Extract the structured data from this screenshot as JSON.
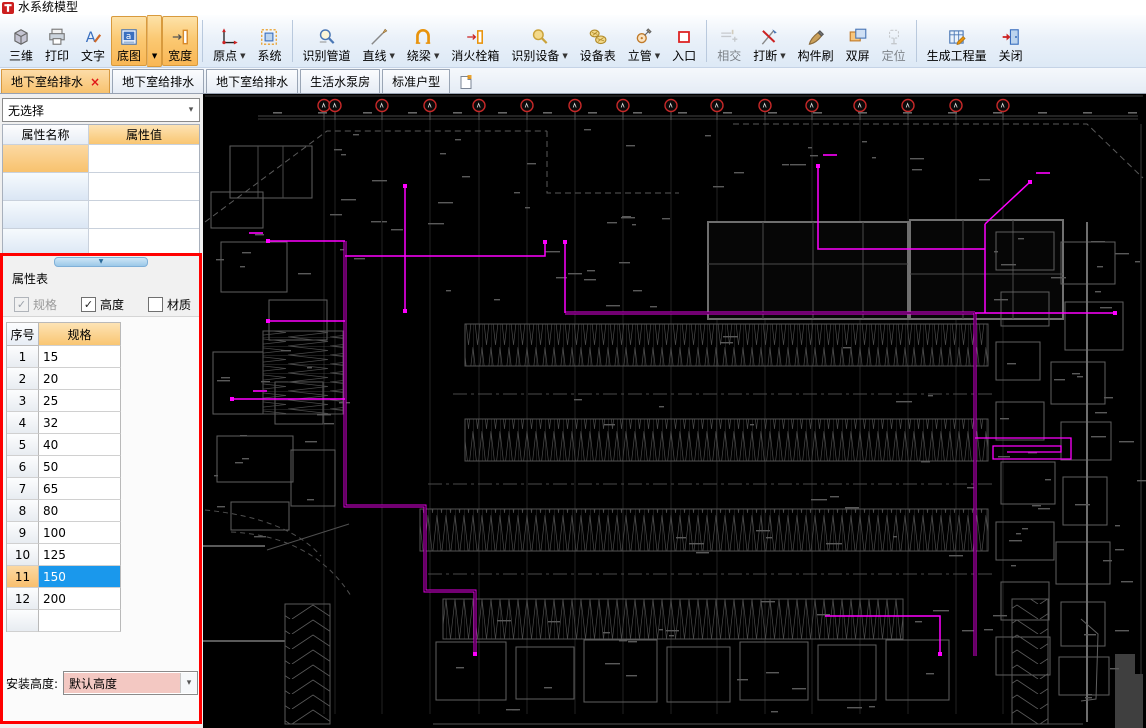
{
  "window": {
    "title": "水系统模型"
  },
  "toolbar": {
    "buttons": [
      {
        "label": "三维",
        "icon": "cube-icon"
      },
      {
        "label": "打印",
        "icon": "printer-icon"
      },
      {
        "label": "文字",
        "icon": "text-icon"
      },
      {
        "label": "底图",
        "icon": "basemap-icon",
        "active": true,
        "split": true
      },
      {
        "label": "宽度",
        "icon": "width-icon",
        "active": true
      },
      {
        "sep": true
      },
      {
        "label": "原点",
        "icon": "origin-icon",
        "dropdown": true
      },
      {
        "label": "系统",
        "icon": "system-icon"
      },
      {
        "sep": true
      },
      {
        "label": "识别管道",
        "icon": "identify-pipe-icon"
      },
      {
        "label": "直线",
        "icon": "line-icon",
        "dropdown": true
      },
      {
        "label": "绕梁",
        "icon": "beam-icon",
        "dropdown": true
      },
      {
        "label": "消火栓箱",
        "icon": "hydrant-icon"
      },
      {
        "label": "识别设备",
        "icon": "identify-device-icon",
        "dropdown": true
      },
      {
        "label": "设备表",
        "icon": "device-table-icon"
      },
      {
        "label": "立管",
        "icon": "riser-icon",
        "dropdown": true
      },
      {
        "label": "入口",
        "icon": "entrance-icon"
      },
      {
        "sep": true
      },
      {
        "label": "相交",
        "icon": "intersect-icon",
        "disabled": true
      },
      {
        "label": "打断",
        "icon": "break-icon",
        "dropdown": true
      },
      {
        "label": "构件刷",
        "icon": "brush-icon"
      },
      {
        "label": "双屏",
        "icon": "dualscreen-icon"
      },
      {
        "label": "定位",
        "icon": "locate-icon",
        "disabled": true
      },
      {
        "sep": true
      },
      {
        "label": "生成工程量",
        "icon": "quantity-icon"
      },
      {
        "label": "关闭",
        "icon": "close-icon"
      }
    ]
  },
  "tabs": [
    {
      "label": "地下室给排水",
      "active": true,
      "close_glyph": "×"
    },
    {
      "label": "地下室给排水"
    },
    {
      "label": "地下室给排水"
    },
    {
      "label": "生活水泵房"
    },
    {
      "label": "标准户型"
    }
  ],
  "left_panel": {
    "selection_dropdown": {
      "value": "无选择"
    },
    "property_grid": {
      "name_header": "属性名称",
      "value_header": "属性值",
      "empty_row_count": 4
    },
    "attribute_panel": {
      "title": "属性表",
      "checkboxes": [
        {
          "name": "spec",
          "label": "规格",
          "checked": true,
          "disabled": true
        },
        {
          "name": "height",
          "label": "高度",
          "checked": true,
          "disabled": false
        },
        {
          "name": "material",
          "label": "材质",
          "checked": false,
          "disabled": false
        }
      ],
      "spec_table": {
        "no_header": "序号",
        "spec_header": "规格",
        "selected_no": "11",
        "rows": [
          {
            "no": "1",
            "spec": "15"
          },
          {
            "no": "2",
            "spec": "20"
          },
          {
            "no": "3",
            "spec": "25"
          },
          {
            "no": "4",
            "spec": "32"
          },
          {
            "no": "5",
            "spec": "40"
          },
          {
            "no": "6",
            "spec": "50"
          },
          {
            "no": "7",
            "spec": "65"
          },
          {
            "no": "8",
            "spec": "80"
          },
          {
            "no": "9",
            "spec": "100"
          },
          {
            "no": "10",
            "spec": "125"
          },
          {
            "no": "11",
            "spec": "150"
          },
          {
            "no": "12",
            "spec": "200"
          },
          {
            "no": "",
            "spec": ""
          }
        ]
      },
      "install_height": {
        "label": "安装高度:",
        "value": "默认高度"
      }
    }
  },
  "canvas": {
    "background": "#000000",
    "cad_line_color": "#6a6a6a",
    "pipe_color": "#ff00ff",
    "grid_bubble_color": "#c62828",
    "grid_bubble_count": 16
  }
}
